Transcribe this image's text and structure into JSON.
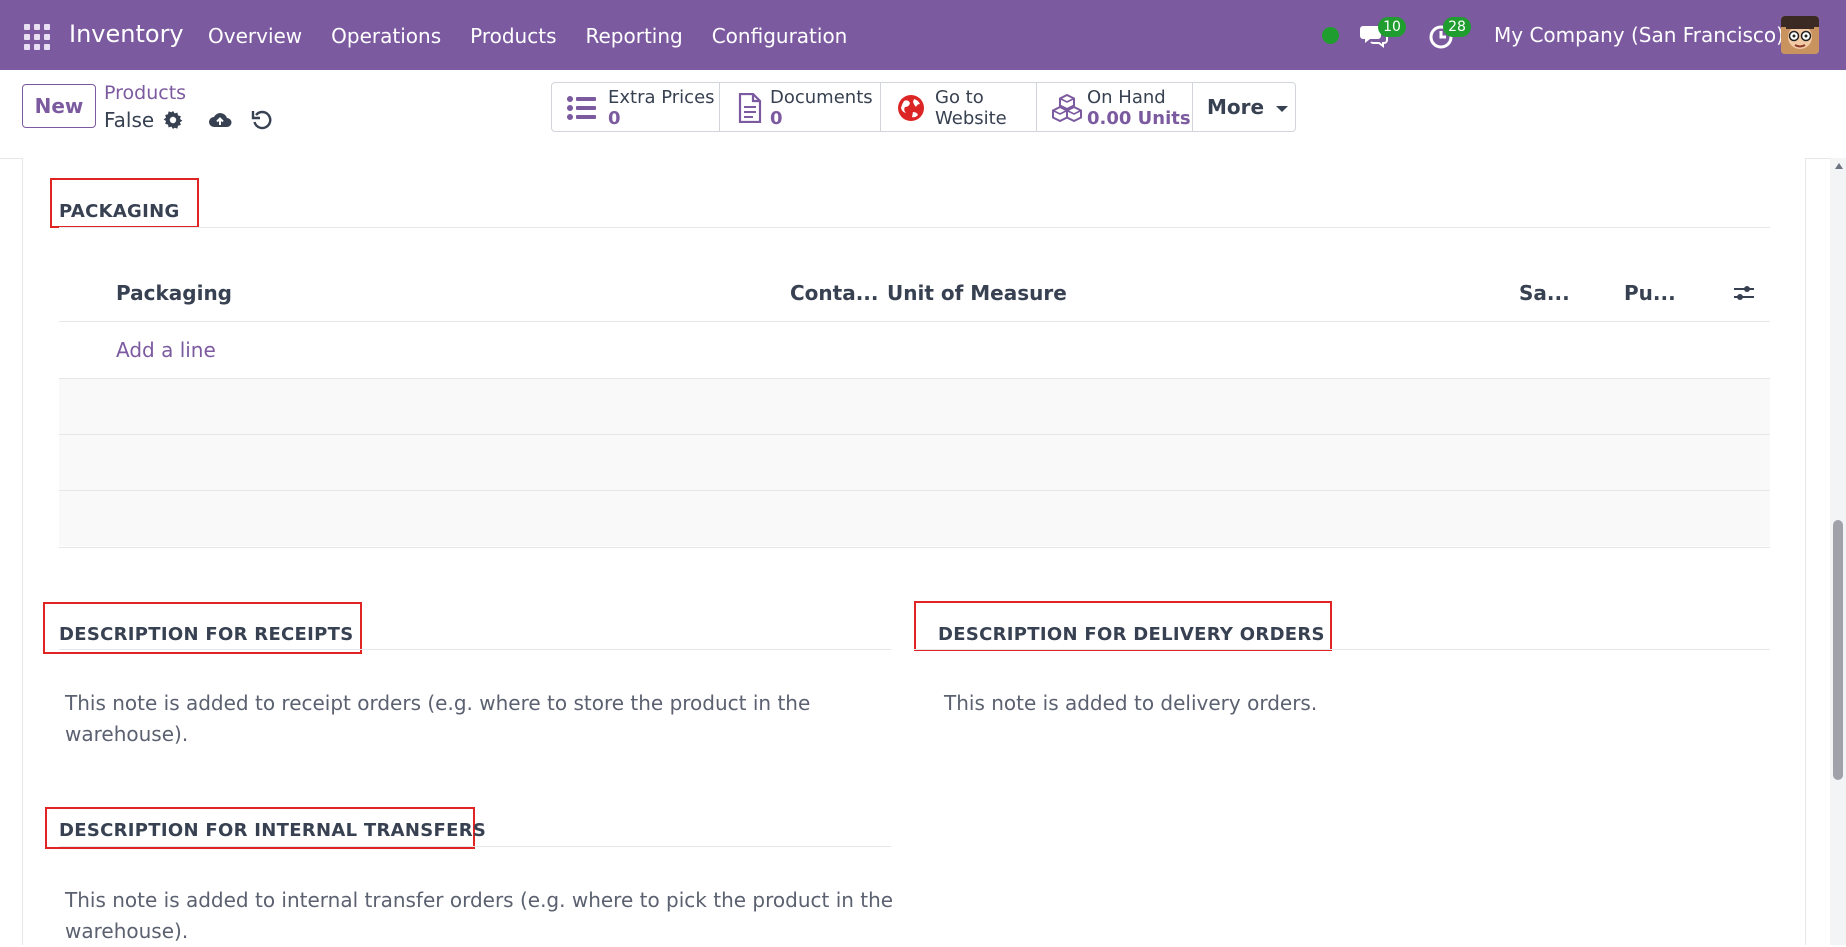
{
  "topbar": {
    "app_name": "Inventory",
    "menu": [
      "Overview",
      "Operations",
      "Products",
      "Reporting",
      "Configuration"
    ],
    "messages_count": "10",
    "activities_count": "28",
    "company": "My Company (San Francisco)",
    "status_color": "#1f9d2e",
    "brand_color": "#7c5aa0"
  },
  "control": {
    "new_label": "New",
    "breadcrumb": "Products",
    "record_name": "False",
    "smart_buttons": {
      "extra_prices": {
        "label": "Extra Prices",
        "value": "0"
      },
      "documents": {
        "label": "Documents",
        "value": "0"
      },
      "website": {
        "line1": "Go to",
        "line2": "Website"
      },
      "on_hand": {
        "label": "On Hand",
        "value": "0.00 Units"
      },
      "more": "More"
    }
  },
  "packaging": {
    "title": "PACKAGING",
    "columns": {
      "packaging": "Packaging",
      "contained": "Conta...",
      "uom": "Unit of Measure",
      "sales": "Sa...",
      "purchase": "Pu..."
    },
    "add_line": "Add a line"
  },
  "descriptions": {
    "receipts": {
      "title": "DESCRIPTION FOR RECEIPTS",
      "line1": "This note is added to receipt orders (e.g. where to store the product in the",
      "line2": "warehouse)."
    },
    "delivery": {
      "title": "DESCRIPTION FOR DELIVERY ORDERS",
      "line1": "This note is added to delivery orders."
    },
    "internal": {
      "title": "DESCRIPTION FOR INTERNAL TRANSFERS",
      "line1": "This note is added to internal transfer orders (e.g. where to pick the product in the",
      "line2": "warehouse)."
    }
  },
  "highlight_color": "#e02424"
}
